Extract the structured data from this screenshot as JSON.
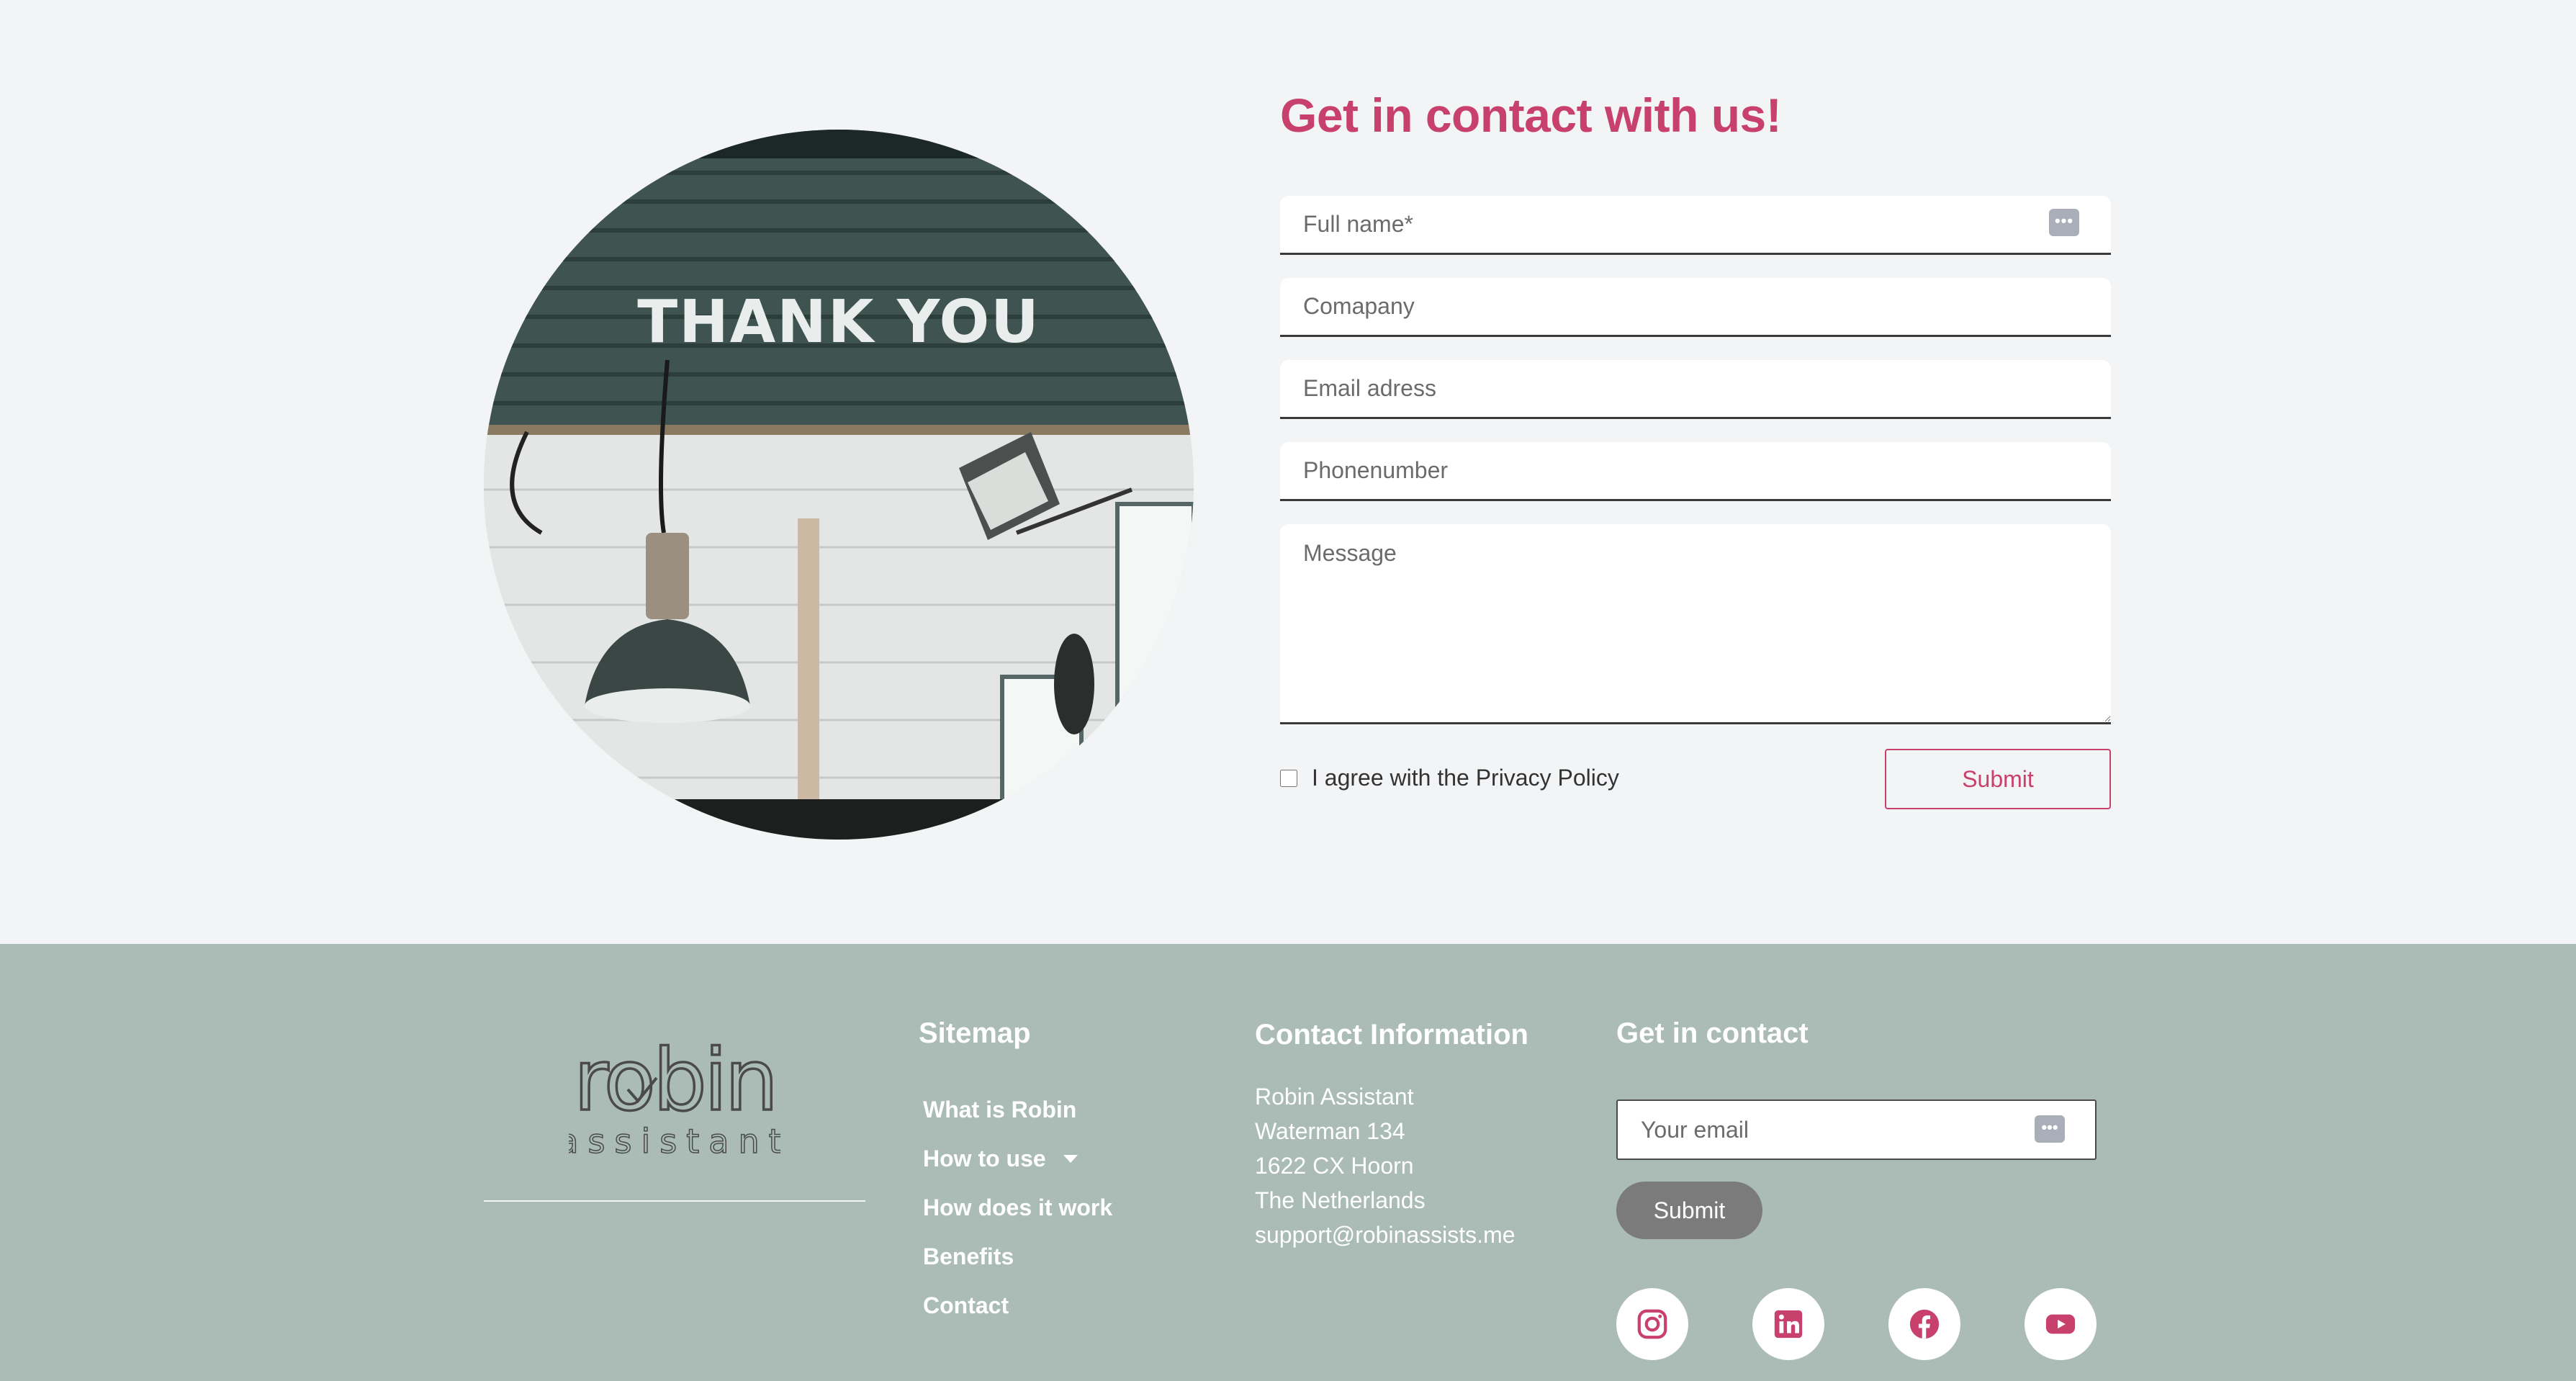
{
  "contact": {
    "title": "Get in contact with us!",
    "photo_text": "THANK YOU",
    "fields": {
      "full_name_placeholder": "Full name*",
      "company_placeholder": "Comapany",
      "email_placeholder": "Email adress",
      "phone_placeholder": "Phonenumber",
      "message_placeholder": "Message"
    },
    "agree_label": "I agree with the Privacy Policy",
    "submit_label": "Submit"
  },
  "footer": {
    "logo_word": "robin",
    "logo_sub": "assistant",
    "sitemap": {
      "title": "Sitemap",
      "items": [
        "What is Robin",
        "How to use",
        "How does it work",
        "Benefits",
        "Contact"
      ]
    },
    "contact_info": {
      "title": "Contact Information",
      "lines": [
        "Robin Assistant",
        "Waterman 134",
        "1622 CX Hoorn",
        "The Netherlands",
        "support@robinassists.me"
      ]
    },
    "get_in_contact": {
      "title": "Get in contact",
      "email_placeholder": "Your email",
      "submit_label": "Submit"
    },
    "social_icons": [
      "instagram-icon",
      "linkedin-icon",
      "facebook-icon",
      "youtube-icon"
    ]
  },
  "colors": {
    "accent": "#c8406c",
    "footer_bg": "#aabcb5",
    "page_bg": "#f3f4f6",
    "button_gray": "#7b7b7b"
  }
}
